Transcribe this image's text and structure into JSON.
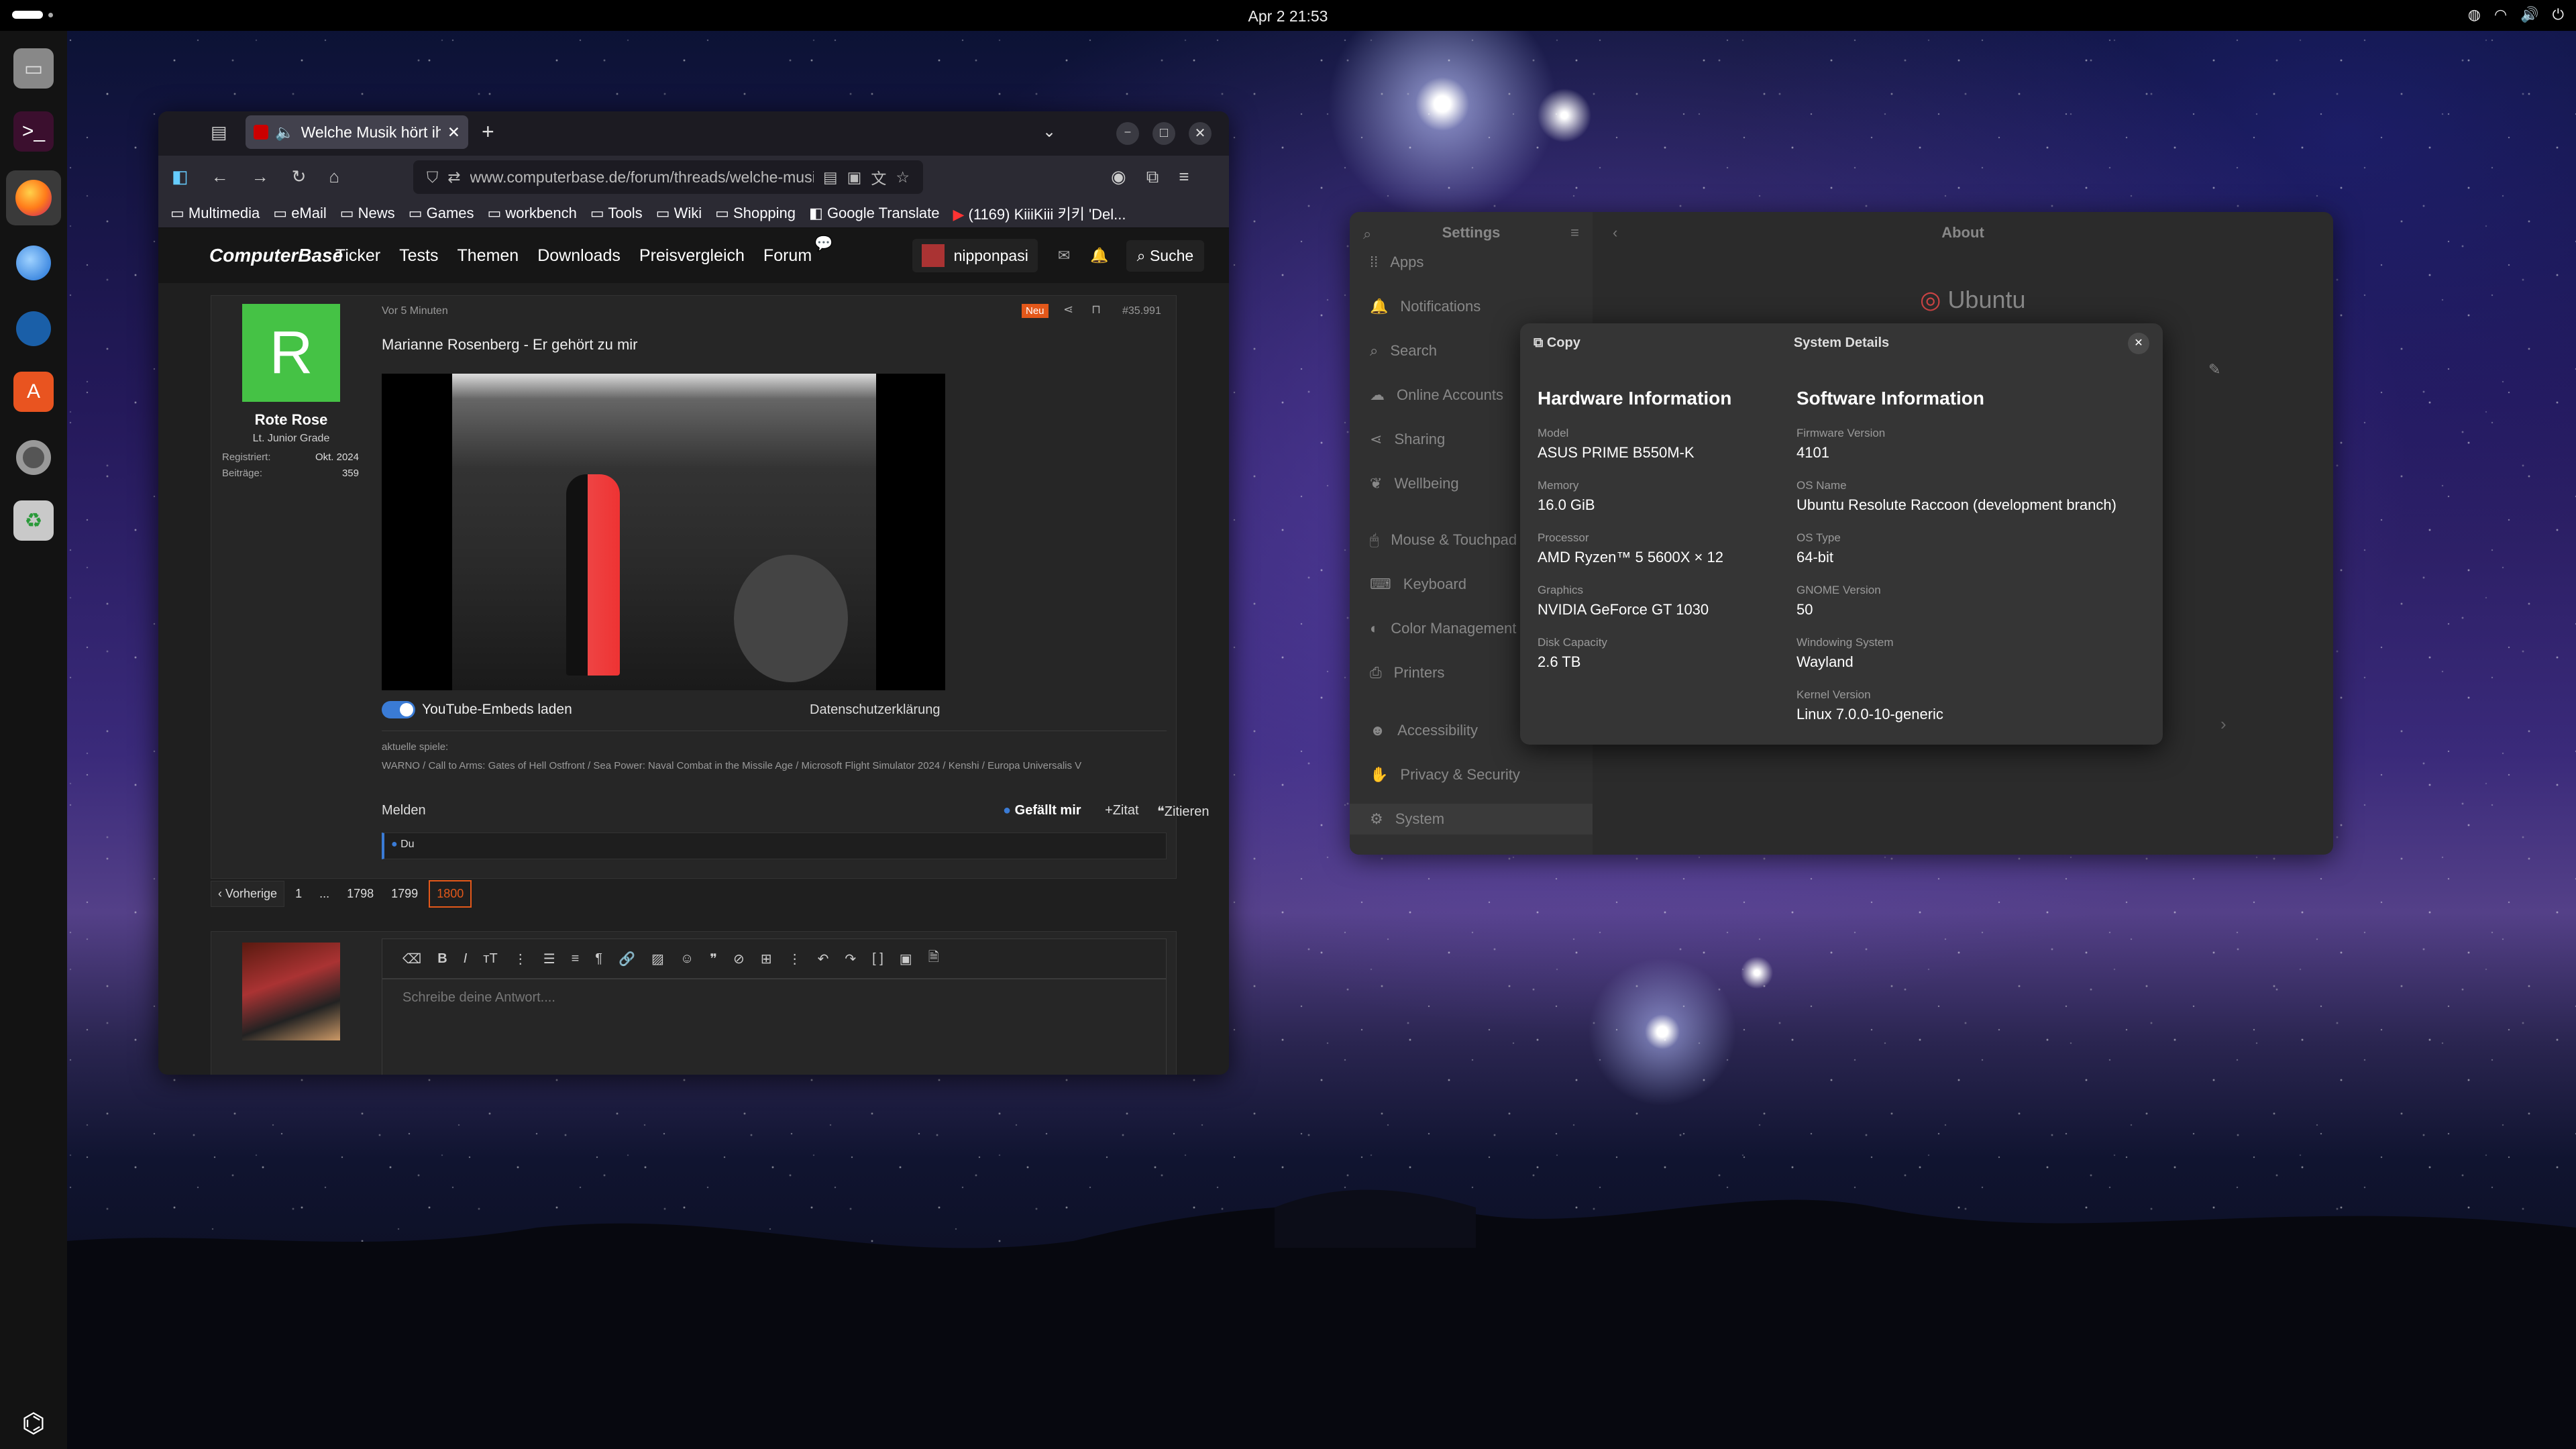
{
  "topbar": {
    "clock": "Apr 2  21:53"
  },
  "browser": {
    "tab_title": "Welche Musik hört ihr",
    "url": "www.computerbase.de/forum/threads/welche-musik-hoert-ihr-g",
    "bookmarks": [
      "Multimedia",
      "eMail",
      "News",
      "Games",
      "workbench",
      "Tools",
      "Wiki",
      "Shopping",
      "Google Translate",
      "(1169) KiiiKiii 키키 'Del..."
    ]
  },
  "site": {
    "logo": "ComputerBase",
    "nav": [
      "Ticker",
      "Tests",
      "Themen",
      "Downloads",
      "Preisvergleich",
      "Forum"
    ],
    "username": "nipponpasi",
    "search": "Suche"
  },
  "post": {
    "user": {
      "initial": "R",
      "name": "Rote Rose",
      "rank": "Lt. Junior Grade",
      "registered_label": "Registriert:",
      "registered": "Okt. 2024",
      "posts_label": "Beiträge:",
      "posts": "359"
    },
    "time": "Vor 5 Minuten",
    "new_badge": "Neu",
    "number": "#35.991",
    "text": "Marianne Rosenberg - Er gehört zu mir",
    "yt_toggle": "YouTube-Embeds laden",
    "privacy": "Datenschutzerklärung",
    "sig_title": "aktuelle spiele:",
    "sig": "WARNO / Call to Arms: Gates of Hell Ostfront / Sea Power: Naval Combat in the Missile Age / Microsoft Flight Simulator 2024 / Kenshi / Europa Universalis V",
    "report": "Melden",
    "like": "Gefällt mir",
    "quote": "Zitat",
    "cite": "Zitieren",
    "reaction": "Du"
  },
  "pagination": {
    "prev": "Vorherige",
    "pages": [
      "1",
      "...",
      "1798",
      "1799",
      "1800"
    ]
  },
  "editor": {
    "placeholder": "Schreibe deine Antwort...."
  },
  "settings": {
    "title": "Settings",
    "about": "About",
    "ubuntu": "Ubuntu",
    "items": [
      "Apps",
      "Notifications",
      "Search",
      "Online Accounts",
      "Sharing",
      "Wellbeing",
      "Mouse & Touchpad",
      "Keyboard",
      "Color Management",
      "Printers",
      "Accessibility",
      "Privacy & Security",
      "System"
    ]
  },
  "dialog": {
    "copy": "Copy",
    "title": "System Details",
    "hw_title": "Hardware Information",
    "sw_title": "Software Information",
    "hw": [
      [
        "Model",
        "ASUS PRIME B550M-K"
      ],
      [
        "Memory",
        "16.0 GiB"
      ],
      [
        "Processor",
        "AMD Ryzen™ 5 5600X × 12"
      ],
      [
        "Graphics",
        "NVIDIA GeForce GT 1030"
      ],
      [
        "Disk Capacity",
        "2.6 TB"
      ]
    ],
    "sw": [
      [
        "Firmware Version",
        "4101"
      ],
      [
        "OS Name",
        "Ubuntu Resolute Raccoon (development branch)"
      ],
      [
        "OS Type",
        "64-bit"
      ],
      [
        "GNOME Version",
        "50"
      ],
      [
        "Windowing System",
        "Wayland"
      ],
      [
        "Kernel Version",
        "Linux 7.0.0-10-generic"
      ]
    ]
  }
}
